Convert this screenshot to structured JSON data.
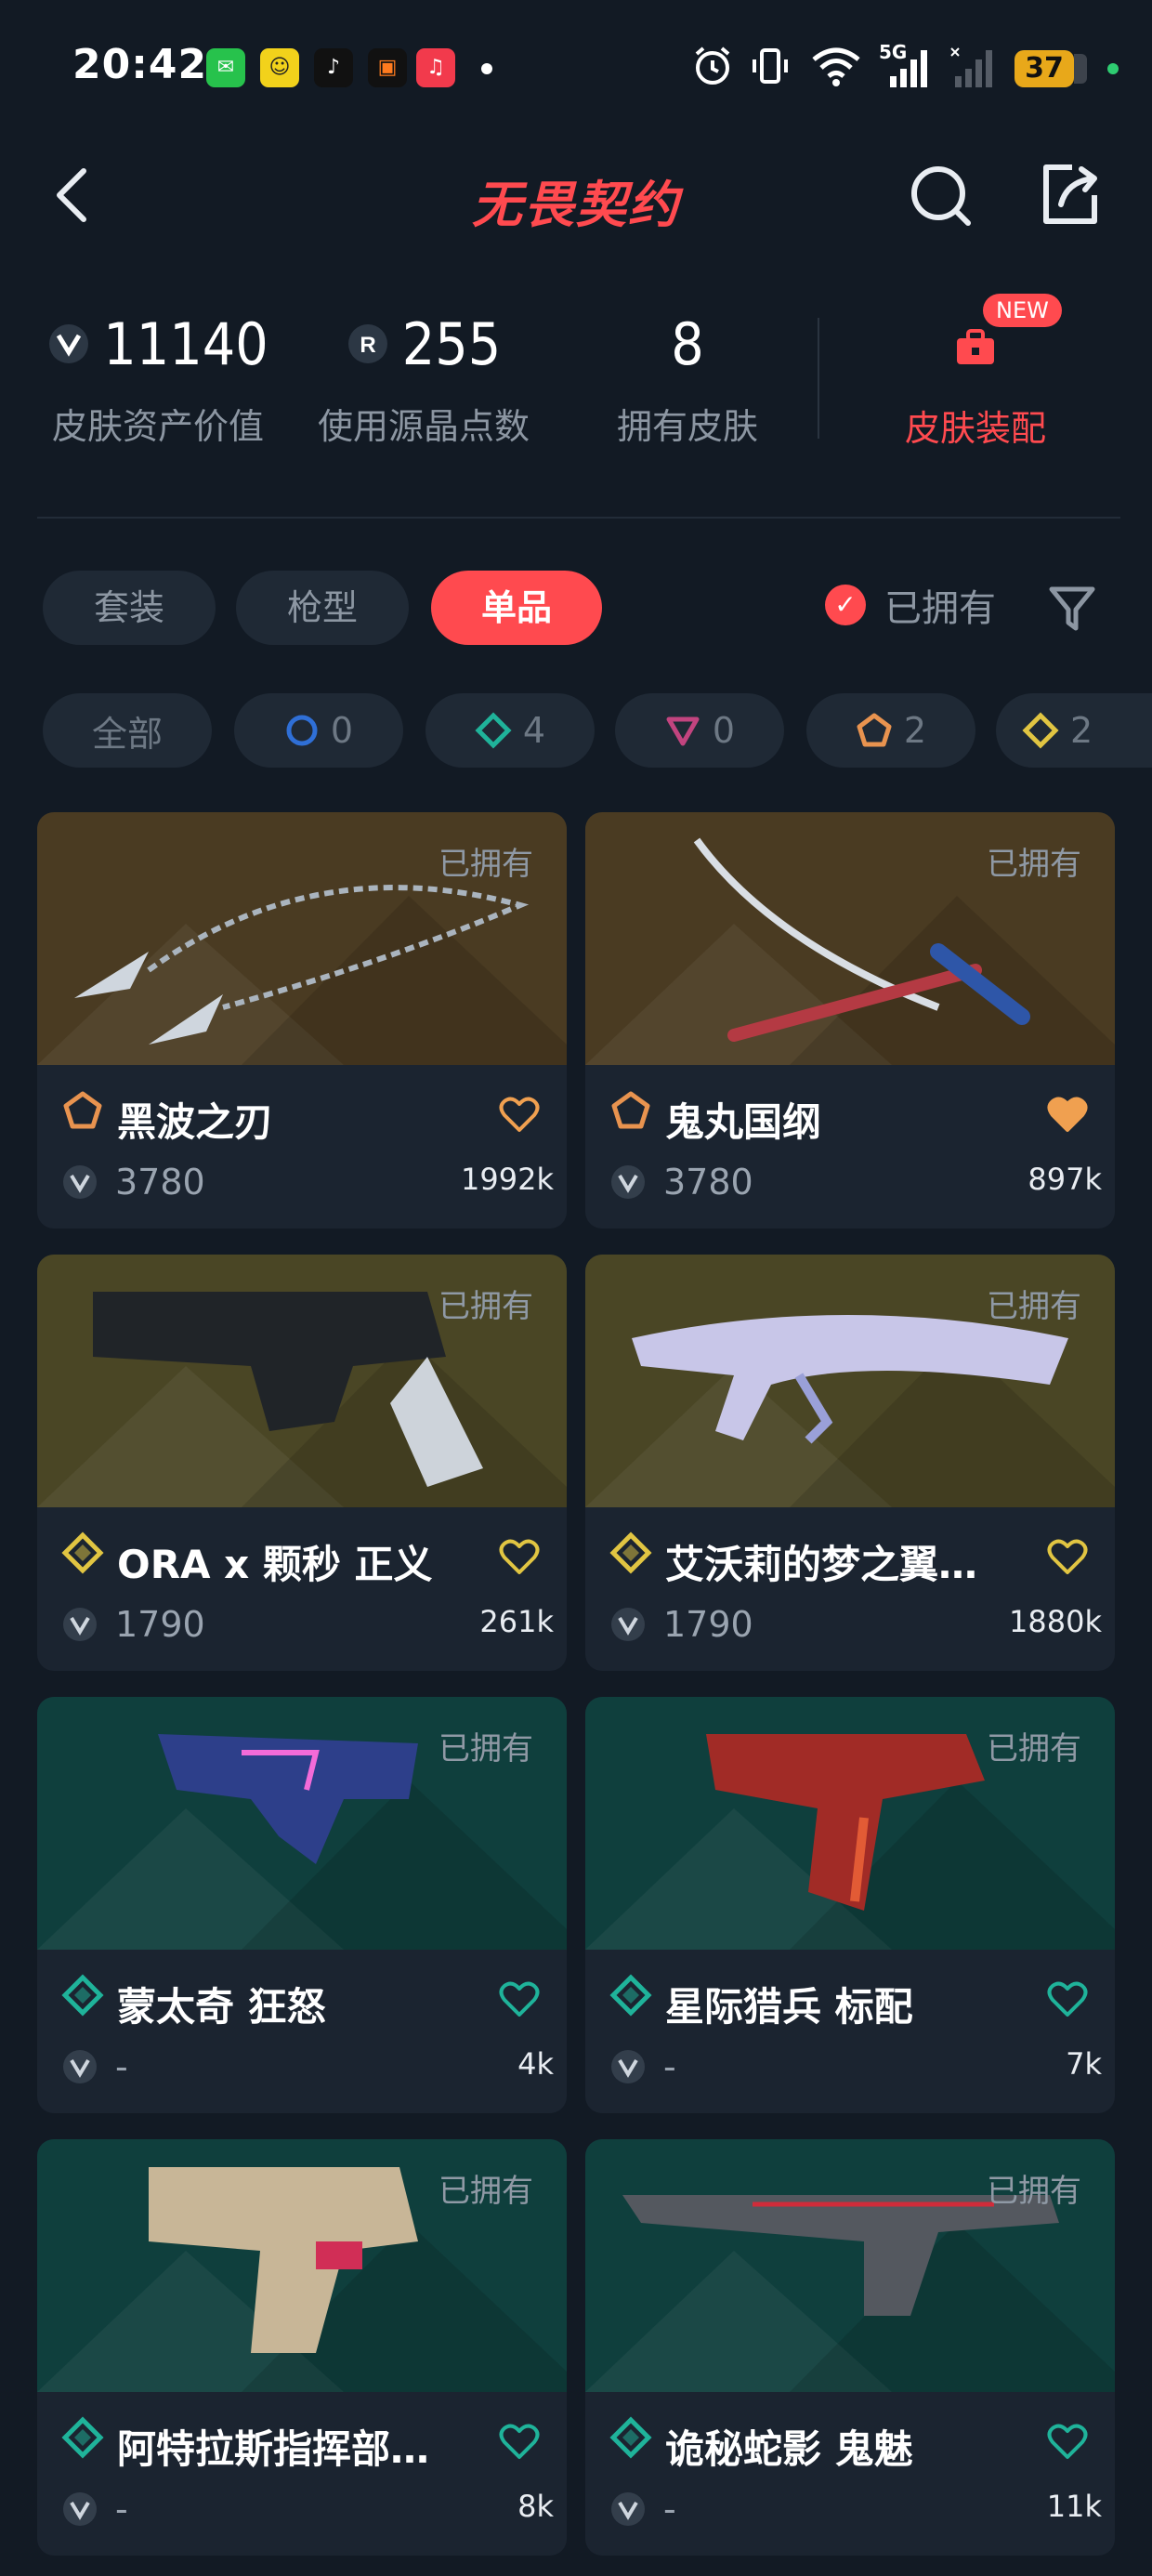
{
  "status_bar": {
    "time": "20:42",
    "battery": "37",
    "network": "5G",
    "icons": [
      "wechat-icon",
      "app-yellow-icon",
      "tiktok-icon",
      "app-orange-icon",
      "music-icon",
      "alarm-icon",
      "vibrate-icon",
      "wifi-icon",
      "signal-icon"
    ]
  },
  "header": {
    "title": "无畏契约",
    "back_icon": "back-icon",
    "search_icon": "search-icon",
    "share_icon": "share-icon"
  },
  "stats": [
    {
      "value": "11140",
      "label": "皮肤资产价值",
      "icon": "vp-icon"
    },
    {
      "value": "255",
      "label": "使用源晶点数",
      "icon": "radianite-icon"
    },
    {
      "value": "8",
      "label": "拥有皮肤"
    }
  ],
  "outfit": {
    "label": "皮肤装配",
    "badge": "NEW",
    "icon": "wardrobe-icon"
  },
  "tabs": [
    {
      "label": "套装",
      "active": false
    },
    {
      "label": "枪型",
      "active": false
    },
    {
      "label": "单品",
      "active": true
    }
  ],
  "owned_filter": {
    "label": "已拥有",
    "checked": true
  },
  "tier_chips": [
    {
      "label": "全部",
      "count": ""
    },
    {
      "count": "0",
      "color": "#2f6fd6",
      "shape": "circle"
    },
    {
      "count": "4",
      "color": "#1fb39a",
      "shape": "diamond"
    },
    {
      "count": "0",
      "color": "#c2447f",
      "shape": "triangle"
    },
    {
      "count": "2",
      "color": "#e8934f",
      "shape": "pentagon"
    },
    {
      "count": "2",
      "color": "#e1c542",
      "shape": "diamond"
    }
  ],
  "cards": [
    {
      "name": "黑波之刃",
      "price": "3780",
      "likes": "1992k",
      "owned": "已拥有",
      "tier": "pentagon",
      "tier_color": "#e8934f",
      "liked": false,
      "heart_color": "#f0a050",
      "bg": "#4a3b22"
    },
    {
      "name": "鬼丸国纲",
      "price": "3780",
      "likes": "897k",
      "owned": "已拥有",
      "tier": "pentagon",
      "tier_color": "#e8934f",
      "liked": true,
      "heart_color": "#f0a050",
      "bg": "#4a3b22"
    },
    {
      "name": "ORA x 颗秒 正义",
      "price": "1790",
      "likes": "261k",
      "owned": "已拥有",
      "tier": "diamond",
      "tier_color": "#e1c542",
      "liked": false,
      "heart_color": "#e1c542",
      "bg": "#4a4625"
    },
    {
      "name": "艾沃莉的梦之翼…",
      "price": "1790",
      "likes": "1880k",
      "owned": "已拥有",
      "tier": "diamond",
      "tier_color": "#e1c542",
      "liked": false,
      "heart_color": "#e1c542",
      "bg": "#4a4625"
    },
    {
      "name": "蒙太奇 狂怒",
      "price": "-",
      "likes": "4k",
      "owned": "已拥有",
      "tier": "diamond",
      "tier_color": "#1fb39a",
      "liked": false,
      "heart_color": "#1fb39a",
      "bg": "#0f3f3d"
    },
    {
      "name": "星际猎兵 标配",
      "price": "-",
      "likes": "7k",
      "owned": "已拥有",
      "tier": "diamond",
      "tier_color": "#1fb39a",
      "liked": false,
      "heart_color": "#1fb39a",
      "bg": "#0f3f3d"
    },
    {
      "name": "阿特拉斯指挥部…",
      "price": "-",
      "likes": "8k",
      "owned": "已拥有",
      "tier": "diamond",
      "tier_color": "#1fb39a",
      "liked": false,
      "heart_color": "#1fb39a",
      "bg": "#0f3f3d"
    },
    {
      "name": "诡秘蛇影 鬼魅",
      "price": "-",
      "likes": "11k",
      "owned": "已拥有",
      "tier": "diamond",
      "tier_color": "#1fb39a",
      "liked": false,
      "heart_color": "#1fb39a",
      "bg": "#0f3f3d"
    }
  ]
}
